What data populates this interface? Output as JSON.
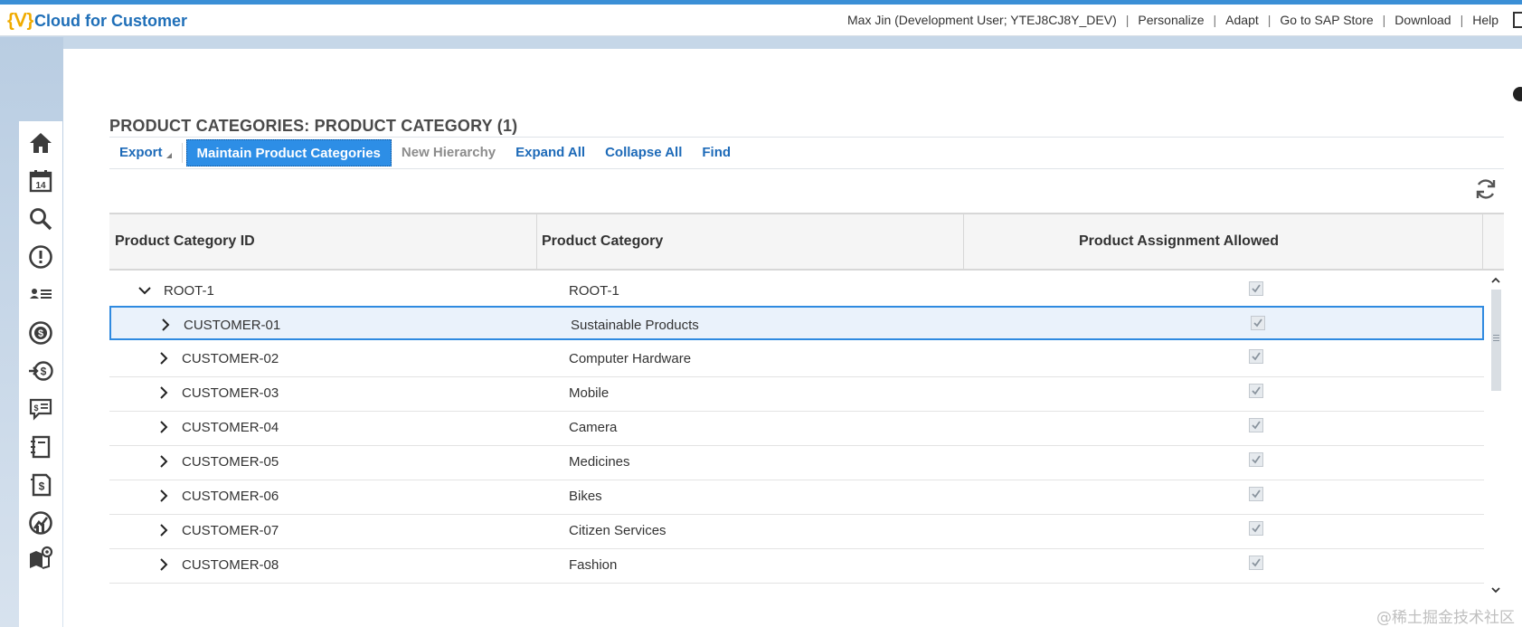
{
  "app": {
    "logo_glyph": "{ᐯ}",
    "title": "Cloud for Customer"
  },
  "shell_links": [
    "Max Jin (Development User; YTEJ8CJ8Y_DEV)",
    "Personalize",
    "Adapt",
    "Go to SAP Store",
    "Download",
    "Help"
  ],
  "page": {
    "title": "PRODUCT CATEGORIES: PRODUCT CATEGORY (1)"
  },
  "toolbar": {
    "export_label": "Export",
    "maintain_label": "Maintain Product Categories",
    "new_hierarchy_label": "New Hierarchy",
    "expand_all_label": "Expand All",
    "collapse_all_label": "Collapse All",
    "find_label": "Find"
  },
  "table": {
    "columns": [
      "Product Category ID",
      "Product Category",
      "Product Assignment Allowed"
    ],
    "rows": [
      {
        "id": "ROOT-1",
        "name": "ROOT-1",
        "allowed": true,
        "level": 0,
        "expanded": true
      },
      {
        "id": "CUSTOMER-01",
        "name": "Sustainable Products",
        "allowed": true,
        "level": 1,
        "expanded": false,
        "selected": true
      },
      {
        "id": "CUSTOMER-02",
        "name": "Computer Hardware",
        "allowed": true,
        "level": 1,
        "expanded": false
      },
      {
        "id": "CUSTOMER-03",
        "name": "Mobile",
        "allowed": true,
        "level": 1,
        "expanded": false
      },
      {
        "id": "CUSTOMER-04",
        "name": "Camera",
        "allowed": true,
        "level": 1,
        "expanded": false
      },
      {
        "id": "CUSTOMER-05",
        "name": "Medicines",
        "allowed": true,
        "level": 1,
        "expanded": false
      },
      {
        "id": "CUSTOMER-06",
        "name": "Bikes",
        "allowed": true,
        "level": 1,
        "expanded": false
      },
      {
        "id": "CUSTOMER-07",
        "name": "Citizen Services",
        "allowed": true,
        "level": 1,
        "expanded": false
      },
      {
        "id": "CUSTOMER-08",
        "name": "Fashion",
        "allowed": true,
        "level": 1,
        "expanded": false
      }
    ]
  },
  "sidebar_icons": [
    "home-icon",
    "calendar-icon",
    "search-icon",
    "alert-icon",
    "contacts-icon",
    "money-icon",
    "payment-icon",
    "quote-icon",
    "notebook-icon",
    "invoice-icon",
    "analytics-icon",
    "map-icon"
  ],
  "calendar_day": "14",
  "watermark": "@稀土掘金技术社区",
  "colors": {
    "accent": "#2d8ee6",
    "link": "#1d6ab8",
    "brand": "#f0ab00"
  }
}
